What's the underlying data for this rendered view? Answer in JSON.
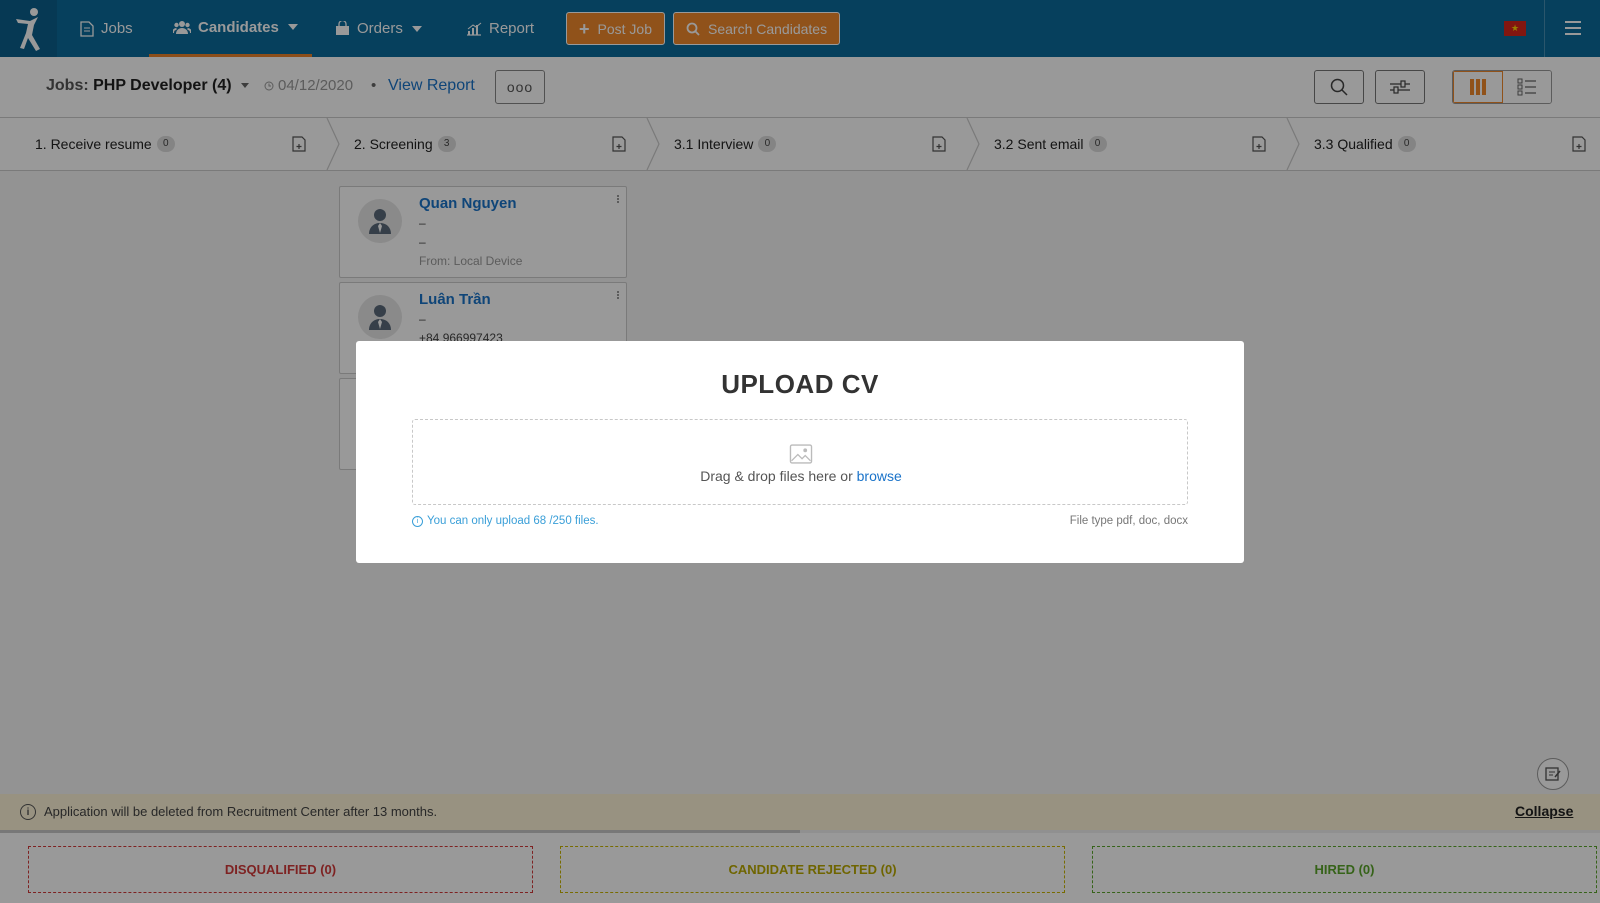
{
  "nav": {
    "items": [
      {
        "label": "Jobs",
        "icon": "document-icon"
      },
      {
        "label": "Candidates",
        "icon": "people-icon"
      },
      {
        "label": "Orders",
        "icon": "bag-icon"
      },
      {
        "label": "Report",
        "icon": "chart-icon"
      }
    ],
    "post_job": "Post Job",
    "search_candidates": "Search Candidates",
    "flag": "vietnam-flag-icon"
  },
  "job": {
    "label": "Jobs:",
    "title": "PHP Developer (4)",
    "date": "04/12/2020",
    "separator": "•",
    "view_report": "View Report",
    "more": "ooo"
  },
  "stages": [
    {
      "label": "1. Receive resume",
      "count": "0"
    },
    {
      "label": "2. Screening",
      "count": "3"
    },
    {
      "label": "3.1 Interview",
      "count": "0"
    },
    {
      "label": "3.2 Sent email",
      "count": "0"
    },
    {
      "label": "3.3 Qualified",
      "count": "0"
    }
  ],
  "cards": [
    {
      "name": "Quan Nguyen",
      "line1": "–",
      "line2": "–",
      "source": "From: Local Device"
    },
    {
      "name": "Luân Trần",
      "line1": "–",
      "line2": "+84 966997423",
      "source": ""
    }
  ],
  "notice": {
    "text": "Application will be deleted from Recruitment Center after 13 months.",
    "collapse": "Collapse"
  },
  "drops": [
    {
      "label": "DISQUALIFIED (0)",
      "color": "#d23a3a"
    },
    {
      "label": "CANDIDATE REJECTED (0)",
      "color": "#c8b400"
    },
    {
      "label": "HIRED (0)",
      "color": "#5aa52a"
    }
  ],
  "modal": {
    "title": "UPLOAD CV",
    "drop_text": "Drag & drop files here or ",
    "browse": "browse",
    "hint": "You can only upload 68 /250 files.",
    "file_types": "File type pdf, doc, docx"
  },
  "colors": {
    "nav_bg": "#0a6b9c",
    "accent": "#f1892c",
    "link": "#1a73c9"
  }
}
